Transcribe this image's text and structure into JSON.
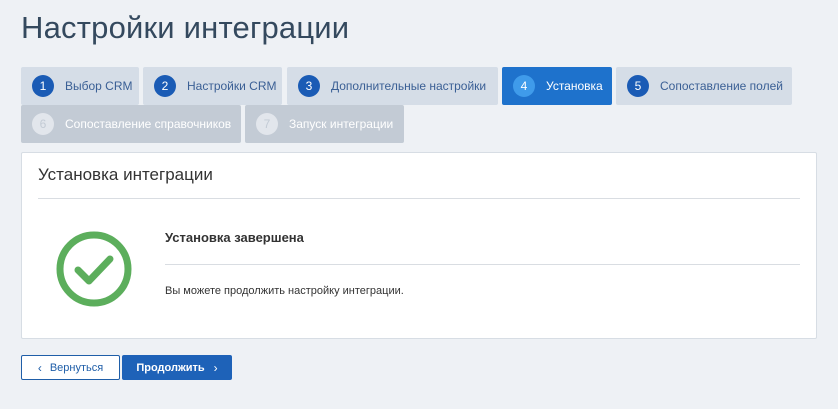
{
  "page": {
    "title": "Настройки интеграции"
  },
  "steps": [
    {
      "num": "1",
      "label": "Выбор CRM",
      "state": "done"
    },
    {
      "num": "2",
      "label": "Настройки CRM",
      "state": "done"
    },
    {
      "num": "3",
      "label": "Дополнительные настройки",
      "state": "done"
    },
    {
      "num": "4",
      "label": "Установка",
      "state": "active"
    },
    {
      "num": "5",
      "label": "Сопоставление полей",
      "state": "done"
    },
    {
      "num": "6",
      "label": "Сопоставление справочников",
      "state": "disabled"
    },
    {
      "num": "7",
      "label": "Запуск интеграции",
      "state": "disabled"
    }
  ],
  "card": {
    "title": "Установка интеграции",
    "status_title": "Установка завершена",
    "status_text": "Вы можете продолжить настройку интеграции.",
    "icon": "check-circle-icon",
    "icon_color": "#5cae5c"
  },
  "buttons": {
    "back_label": "Вернуться",
    "next_label": "Продолжить"
  },
  "colors": {
    "accent": "#1e72cc",
    "primary_button": "#1e62b8",
    "step_number": "#1a5bb5"
  }
}
